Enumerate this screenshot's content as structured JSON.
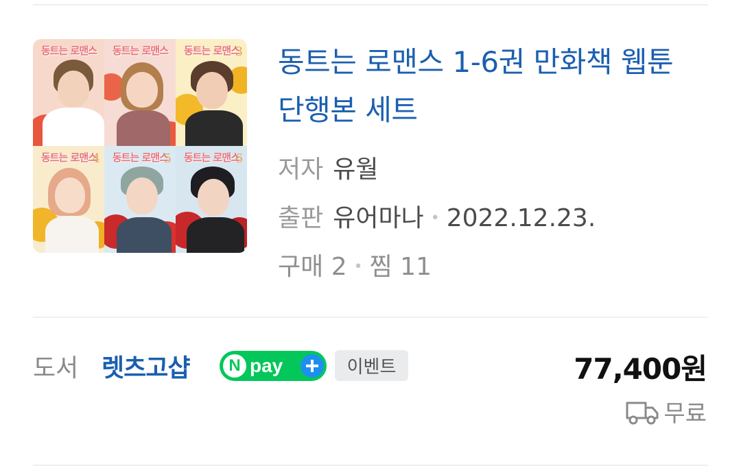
{
  "product": {
    "cover_volumes": [
      {
        "title": "동트는 로맨스",
        "number": ""
      },
      {
        "title": "동트는 로맨스",
        "number": ""
      },
      {
        "title": "동트는 로맨스",
        "number": "3"
      },
      {
        "title": "동트는 로맨스",
        "number": "4"
      },
      {
        "title": "동트는 로맨스",
        "number": "5"
      },
      {
        "title": "동트는 로맨스",
        "number": "6"
      }
    ],
    "title": "동트는 로맨스 1-6권 만화책 웹툰 단행본 세트",
    "author_label": "저자",
    "author": "유월",
    "publisher_label": "출판",
    "publisher": "유어마나",
    "pub_date": "2022.12.23.",
    "purchase_label": "구매",
    "purchase_count": "2",
    "wish_label": "찜",
    "wish_count": "11"
  },
  "seller": {
    "category": "도서",
    "store_name": "렛츠고샵",
    "npay_n": "N",
    "npay_text": "pay",
    "event_label": "이벤트",
    "price": "77,400원",
    "delivery": "무료"
  },
  "colors": {
    "link_blue": "#1b5fb0",
    "npay_green": "#03c75a",
    "npay_plus_blue": "#1e8ff0"
  },
  "icons": {
    "delivery": "truck-icon"
  }
}
